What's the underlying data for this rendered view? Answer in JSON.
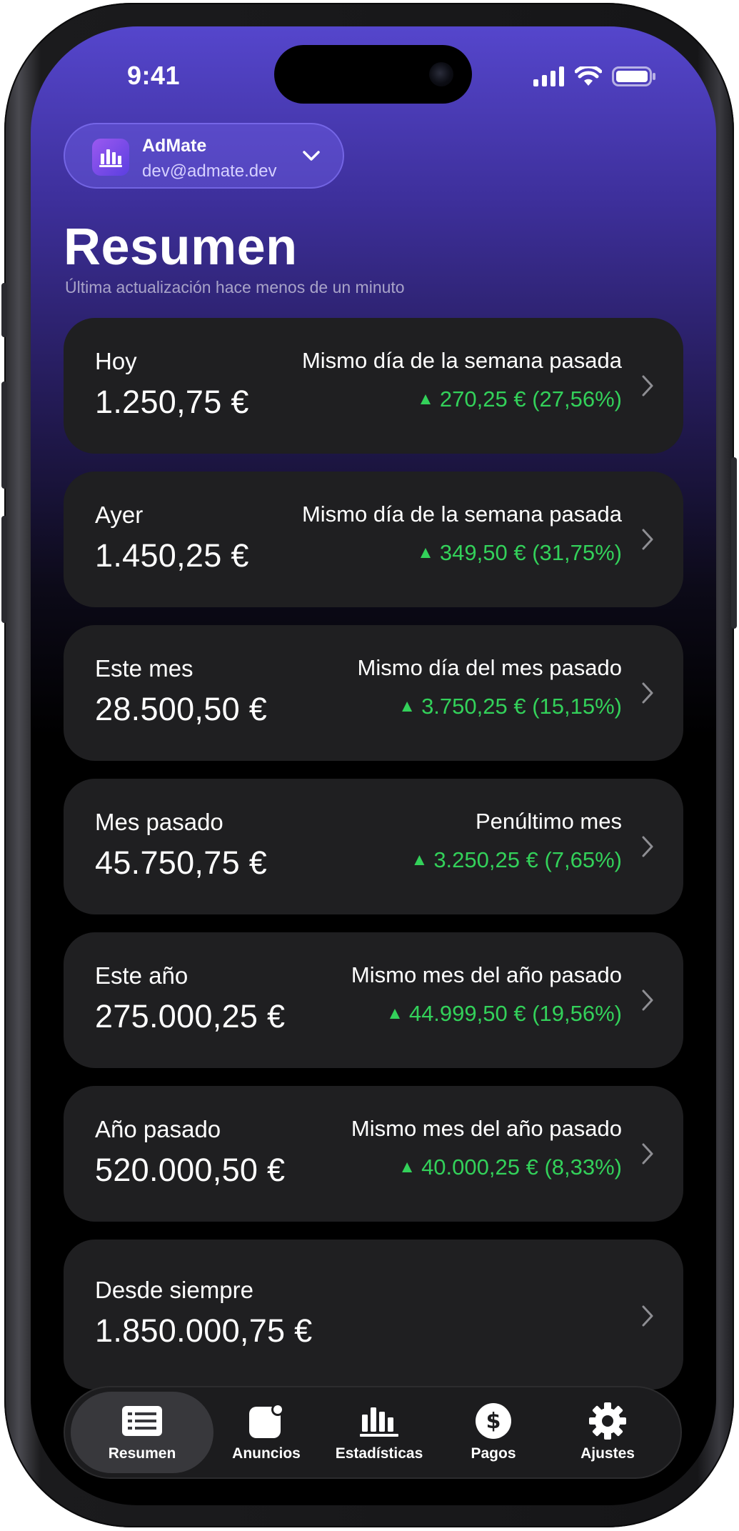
{
  "status_bar": {
    "time": "9:41"
  },
  "account": {
    "name": "AdMate",
    "email": "dev@admate.dev"
  },
  "header": {
    "title": "Resumen",
    "subtitle": "Última actualización hace menos de un minuto"
  },
  "cards": [
    {
      "label": "Hoy",
      "value": "1.250,75 €",
      "compare": "Mismo día de la semana pasada",
      "delta": "270,25 € (27,56%)"
    },
    {
      "label": "Ayer",
      "value": "1.450,25 €",
      "compare": "Mismo día de la semana pasada",
      "delta": "349,50 € (31,75%)"
    },
    {
      "label": "Este mes",
      "value": "28.500,50 €",
      "compare": "Mismo día del mes pasado",
      "delta": "3.750,25 € (15,15%)"
    },
    {
      "label": "Mes pasado",
      "value": "45.750,75 €",
      "compare": "Penúltimo mes",
      "delta": "3.250,25 € (7,65%)"
    },
    {
      "label": "Este año",
      "value": "275.000,25 €",
      "compare": "Mismo mes del año pasado",
      "delta": "44.999,50 € (19,56%)"
    },
    {
      "label": "Año pasado",
      "value": "520.000,50 €",
      "compare": "Mismo mes del año pasado",
      "delta": "40.000,25 € (8,33%)"
    },
    {
      "label": "Desde siempre",
      "value": "1.850.000,75 €"
    }
  ],
  "tabs": [
    {
      "label": "Resumen",
      "icon": "summary-icon"
    },
    {
      "label": "Anuncios",
      "icon": "ads-icon"
    },
    {
      "label": "Estadísticas",
      "icon": "stats-icon"
    },
    {
      "label": "Pagos",
      "icon": "dollar-icon"
    },
    {
      "label": "Ajustes",
      "icon": "gear-icon"
    }
  ],
  "colors": {
    "accent": "#5546cc",
    "positive": "#33d15a",
    "card": "#1f1f21"
  }
}
